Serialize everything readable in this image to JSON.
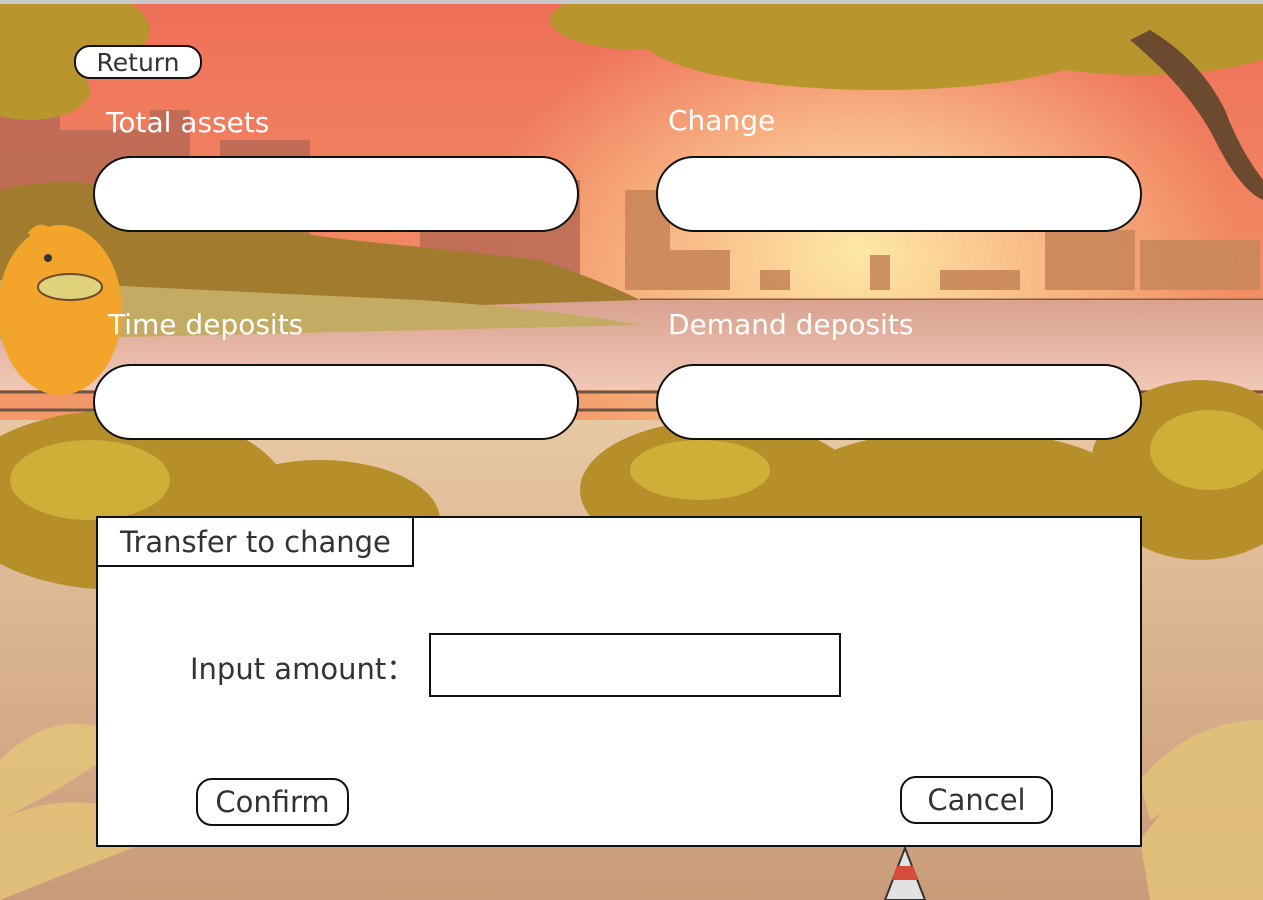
{
  "header": {
    "return_label": "Return"
  },
  "fields": {
    "total_assets": {
      "label": "Total assets",
      "value": ""
    },
    "change": {
      "label": "Change",
      "value": ""
    },
    "time_deposits": {
      "label": "Time deposits",
      "value": ""
    },
    "demand_deposits": {
      "label": "Demand deposits",
      "value": ""
    }
  },
  "dialog": {
    "title": "Transfer to change",
    "amount_label": "Input amount：",
    "amount_value": "",
    "confirm_label": "Confirm",
    "cancel_label": "Cancel"
  },
  "colors": {
    "sky_top": "#f07a5c",
    "sky_bottom": "#f6c15a",
    "foliage": "#c9a233",
    "water": "#e9b9a6",
    "dialog_bg": "#ffffff",
    "border": "#111111"
  }
}
